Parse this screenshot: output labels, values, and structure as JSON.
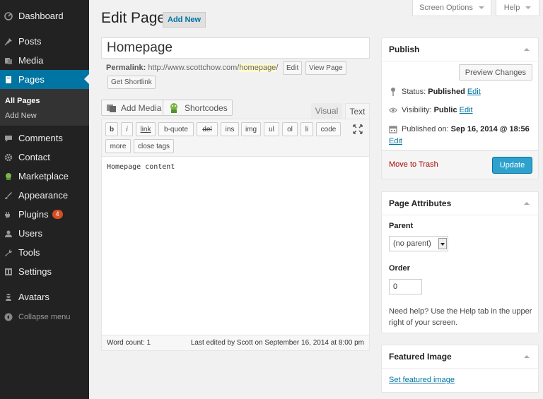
{
  "sidebar": {
    "items": [
      {
        "label": "Dashboard",
        "icon": "dashboard-icon"
      },
      {
        "label": "Posts",
        "icon": "pin-icon"
      },
      {
        "label": "Media",
        "icon": "media-icon"
      },
      {
        "label": "Pages",
        "icon": "pages-icon"
      },
      {
        "label": "Comments",
        "icon": "comment-icon"
      },
      {
        "label": "Contact",
        "icon": "gear-icon"
      },
      {
        "label": "Marketplace",
        "icon": "marketplace-icon"
      },
      {
        "label": "Appearance",
        "icon": "brush-icon"
      },
      {
        "label": "Plugins",
        "icon": "plug-icon",
        "badge": "4"
      },
      {
        "label": "Users",
        "icon": "user-icon"
      },
      {
        "label": "Tools",
        "icon": "wrench-icon"
      },
      {
        "label": "Settings",
        "icon": "settings-icon"
      },
      {
        "label": "Avatars",
        "icon": "avatar-icon"
      },
      {
        "label": "Collapse menu",
        "icon": "collapse-icon"
      }
    ],
    "submenu": [
      "All Pages",
      "Add New"
    ],
    "accent_color": "#0074a2"
  },
  "header": {
    "screen_options": "Screen Options",
    "help": "Help",
    "title": "Edit Page",
    "add_new": "Add New"
  },
  "editor": {
    "title_value": "Homepage",
    "permalink_label": "Permalink:",
    "permalink_base": "http://www.scottchow.com/",
    "permalink_slug": "homepage",
    "permalink_tail": "/",
    "edit_btn": "Edit",
    "view_page_btn": "View Page",
    "shortlink_btn": "Get Shortlink",
    "add_media": "Add Media",
    "shortcodes": "Shortcodes",
    "tab_visual": "Visual",
    "tab_text": "Text",
    "quicktags": [
      "b",
      "i",
      "link",
      "b-quote",
      "del",
      "ins",
      "img",
      "ul",
      "ol",
      "li",
      "code"
    ],
    "quicktags_row2": [
      "more",
      "close tags"
    ],
    "content": "Homepage content",
    "word_count": "Word count: 1",
    "last_edited": "Last edited by Scott on September 16, 2014 at 8:00 pm"
  },
  "publish": {
    "title": "Publish",
    "preview": "Preview Changes",
    "status_label": "Status:",
    "status_value": "Published",
    "visibility_label": "Visibility:",
    "visibility_value": "Public",
    "published_label": "Published on:",
    "published_value": "Sep 16, 2014 @ 18:56",
    "edit_link": "Edit",
    "trash": "Move to Trash",
    "update": "Update"
  },
  "attributes": {
    "title": "Page Attributes",
    "parent_label": "Parent",
    "parent_value": "(no parent)",
    "order_label": "Order",
    "order_value": "0",
    "help": "Need help? Use the Help tab in the upper right of your screen."
  },
  "featured": {
    "title": "Featured Image",
    "link": "Set featured image"
  }
}
